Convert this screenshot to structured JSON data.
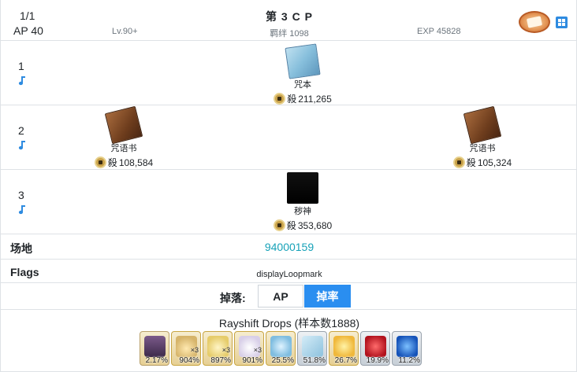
{
  "header": {
    "stage": "1/1",
    "ap": "AP 40",
    "title": "第 3 C P",
    "level": "Lv.90+",
    "bond": "羁绊 1098",
    "exp": "EXP 45828",
    "plate_icon": "quest-plate-icon",
    "layout_button_icon": "grid-toggle-icon"
  },
  "waves": [
    {
      "number": "1",
      "icon": "music-note-icon",
      "enemies": [
        {
          "name": "咒本",
          "hp": "211,265",
          "hp_label": "殺",
          "class_icon": "berserker-class-icon",
          "art": "codex-enemy-icon"
        }
      ]
    },
    {
      "number": "2",
      "icon": "music-note-icon",
      "enemies": [
        {
          "name": "咒语书",
          "hp": "108,584",
          "hp_label": "殺",
          "class_icon": "berserker-class-icon",
          "art": "spellbook-enemy-icon"
        },
        {
          "name": "咒语书",
          "hp": "105,324",
          "hp_label": "殺",
          "class_icon": "berserker-class-icon",
          "art": "spellbook-enemy-icon"
        }
      ]
    },
    {
      "number": "3",
      "icon": "music-note-icon",
      "enemies": [
        {
          "name": "秽神",
          "hp": "353,680",
          "hp_label": "殺",
          "class_icon": "berserker-class-icon",
          "art": "dark-god-enemy-icon"
        }
      ]
    }
  ],
  "field": {
    "label": "场地",
    "value": "94000159"
  },
  "flags": {
    "label": "Flags",
    "value": "displayLoopmark"
  },
  "drops": {
    "label": "掉落:",
    "tab_ap": "AP",
    "tab_rate": "掉率",
    "active_tab": "rate",
    "rayshift": "Rayshift Drops (样本数1888)",
    "items": [
      {
        "art": "servant-portrait-icon",
        "mult": "",
        "pct": "2.17%"
      },
      {
        "art": "cake-icon",
        "mult": "×3",
        "pct": "904%"
      },
      {
        "art": "sweet-icon",
        "mult": "×3",
        "pct": "897%"
      },
      {
        "art": "cream-icon",
        "mult": "×3",
        "pct": "901%"
      },
      {
        "art": "mirror-icon",
        "mult": "",
        "pct": "25.5%"
      },
      {
        "art": "codex-material-icon",
        "mult": "",
        "pct": "51.8%"
      },
      {
        "art": "sun-material-icon",
        "mult": "",
        "pct": "26.7%"
      },
      {
        "art": "red-gem-icon",
        "mult": "",
        "pct": "19.9%"
      },
      {
        "art": "blue-gem-icon",
        "mult": "",
        "pct": "11.2%"
      }
    ]
  }
}
